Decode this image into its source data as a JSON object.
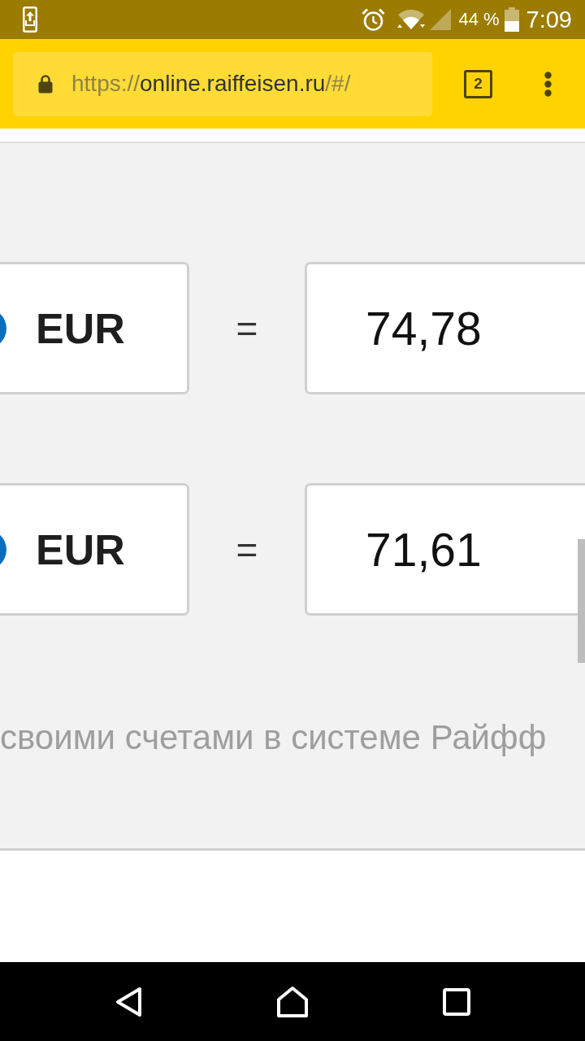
{
  "status_bar": {
    "battery_percent": "44 %",
    "time": "7:09"
  },
  "browser_toolbar": {
    "url": {
      "scheme": "https://",
      "host": "online.raiffeisen.ru",
      "path": "/#/"
    },
    "tab_count": "2"
  },
  "converter_rows": [
    {
      "currency": "EUR",
      "operator": "=",
      "value": "74,78"
    },
    {
      "currency": "EUR",
      "operator": "=",
      "value": "71,61"
    }
  ],
  "caption": "своими счетами в системе Райфф"
}
